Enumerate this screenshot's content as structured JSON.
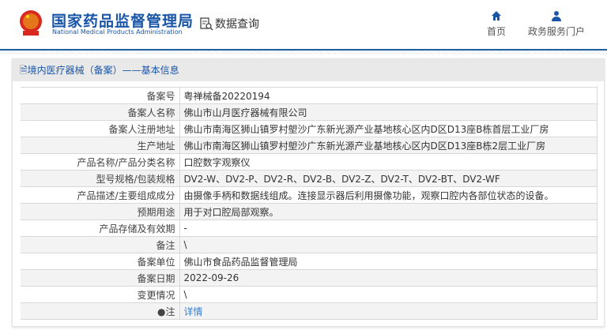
{
  "header": {
    "title_cn": "国家药品监督管理局",
    "title_en": "National Medical Products Administration",
    "query": "数据查询",
    "nav": [
      {
        "label": "首页",
        "icon": "home-icon"
      },
      {
        "label": "政务服务门户",
        "icon": "user-icon"
      }
    ]
  },
  "panel": {
    "title": "境内医疗器械（备案）——基本信息"
  },
  "rows": [
    {
      "label": "备案号",
      "value": "粤禅械备20220194"
    },
    {
      "label": "备案人名称",
      "value": "佛山市山月医疗器械有限公司"
    },
    {
      "label": "备案人注册地址",
      "value": "佛山市南海区狮山镇罗村塱沙广东新光源产业基地核心区内D区D13座B栋首层工业厂房"
    },
    {
      "label": "生产地址",
      "value": "佛山市南海区狮山镇罗村塱沙广东新光源产业基地核心区内D区D13座B栋2层工业厂房"
    },
    {
      "label": "产品名称/产品分类名称",
      "value": "口腔数字观察仪"
    },
    {
      "label": "型号规格/包装规格",
      "value": "DV2-W、DV2-P、DV2-R、DV2-B、DV2-Z、DV2-T、DV2-BT、DV2-WF"
    },
    {
      "label": "产品描述/主要组成成分",
      "value": "由摄像手柄和数据线组成。连接显示器后利用摄像功能，观察口腔内各部位状态的设备。"
    },
    {
      "label": "预期用途",
      "value": "用于对口腔局部观察。"
    },
    {
      "label": "产品存储及有效期",
      "value": "-"
    },
    {
      "label": "备注",
      "value": "\\"
    },
    {
      "label": "备案单位",
      "value": "佛山市食品药品监督管理局"
    },
    {
      "label": "备案日期",
      "value": "2022-09-26"
    },
    {
      "label": "变更情况",
      "value": "\\"
    },
    {
      "label": "注",
      "value": "详情"
    }
  ]
}
